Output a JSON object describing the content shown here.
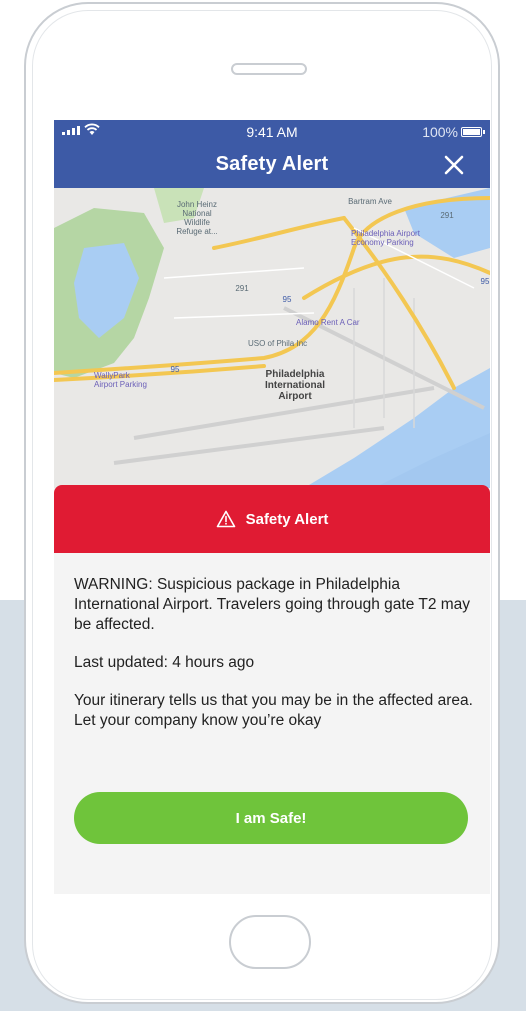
{
  "status_bar": {
    "time": "9:41 AM",
    "battery": "100%"
  },
  "header": {
    "title": "Safety Alert",
    "close_icon": "close-icon"
  },
  "map": {
    "labels": {
      "heinz": "John Heinz\nNational\nWildlife\nRefuge at...",
      "economy_parking": "Philadelphia Airport\nEconomy Parking",
      "alamo": "Alamo Rent A Car",
      "uso": "USO of Phila Inc",
      "airport": "Philadelphia\nInternational\nAirport",
      "wallypark": "WallyPark\nAirport Parking",
      "bartram": "Bartram Ave",
      "route291_a": "291",
      "route291_b": "291",
      "route95_a": "95",
      "route95_b": "95",
      "route95_c": "95"
    }
  },
  "alert": {
    "title": "Safety Alert",
    "icon": "warning-icon",
    "message": "WARNING: Suspicious package in Philadelphia International Airport. Travelers going through gate T2 may be affected.",
    "last_updated": "Last updated: 4 hours ago",
    "itinerary_note": "Your itinerary tells us that you may be in the affected area. Let your company know you’re okay"
  },
  "actions": {
    "safe_button": "I am Safe!"
  },
  "colors": {
    "header": "#3d5aa6",
    "alert": "#e01b33",
    "safe_button": "#6fc43b",
    "background_band": "#d6dfe7"
  }
}
